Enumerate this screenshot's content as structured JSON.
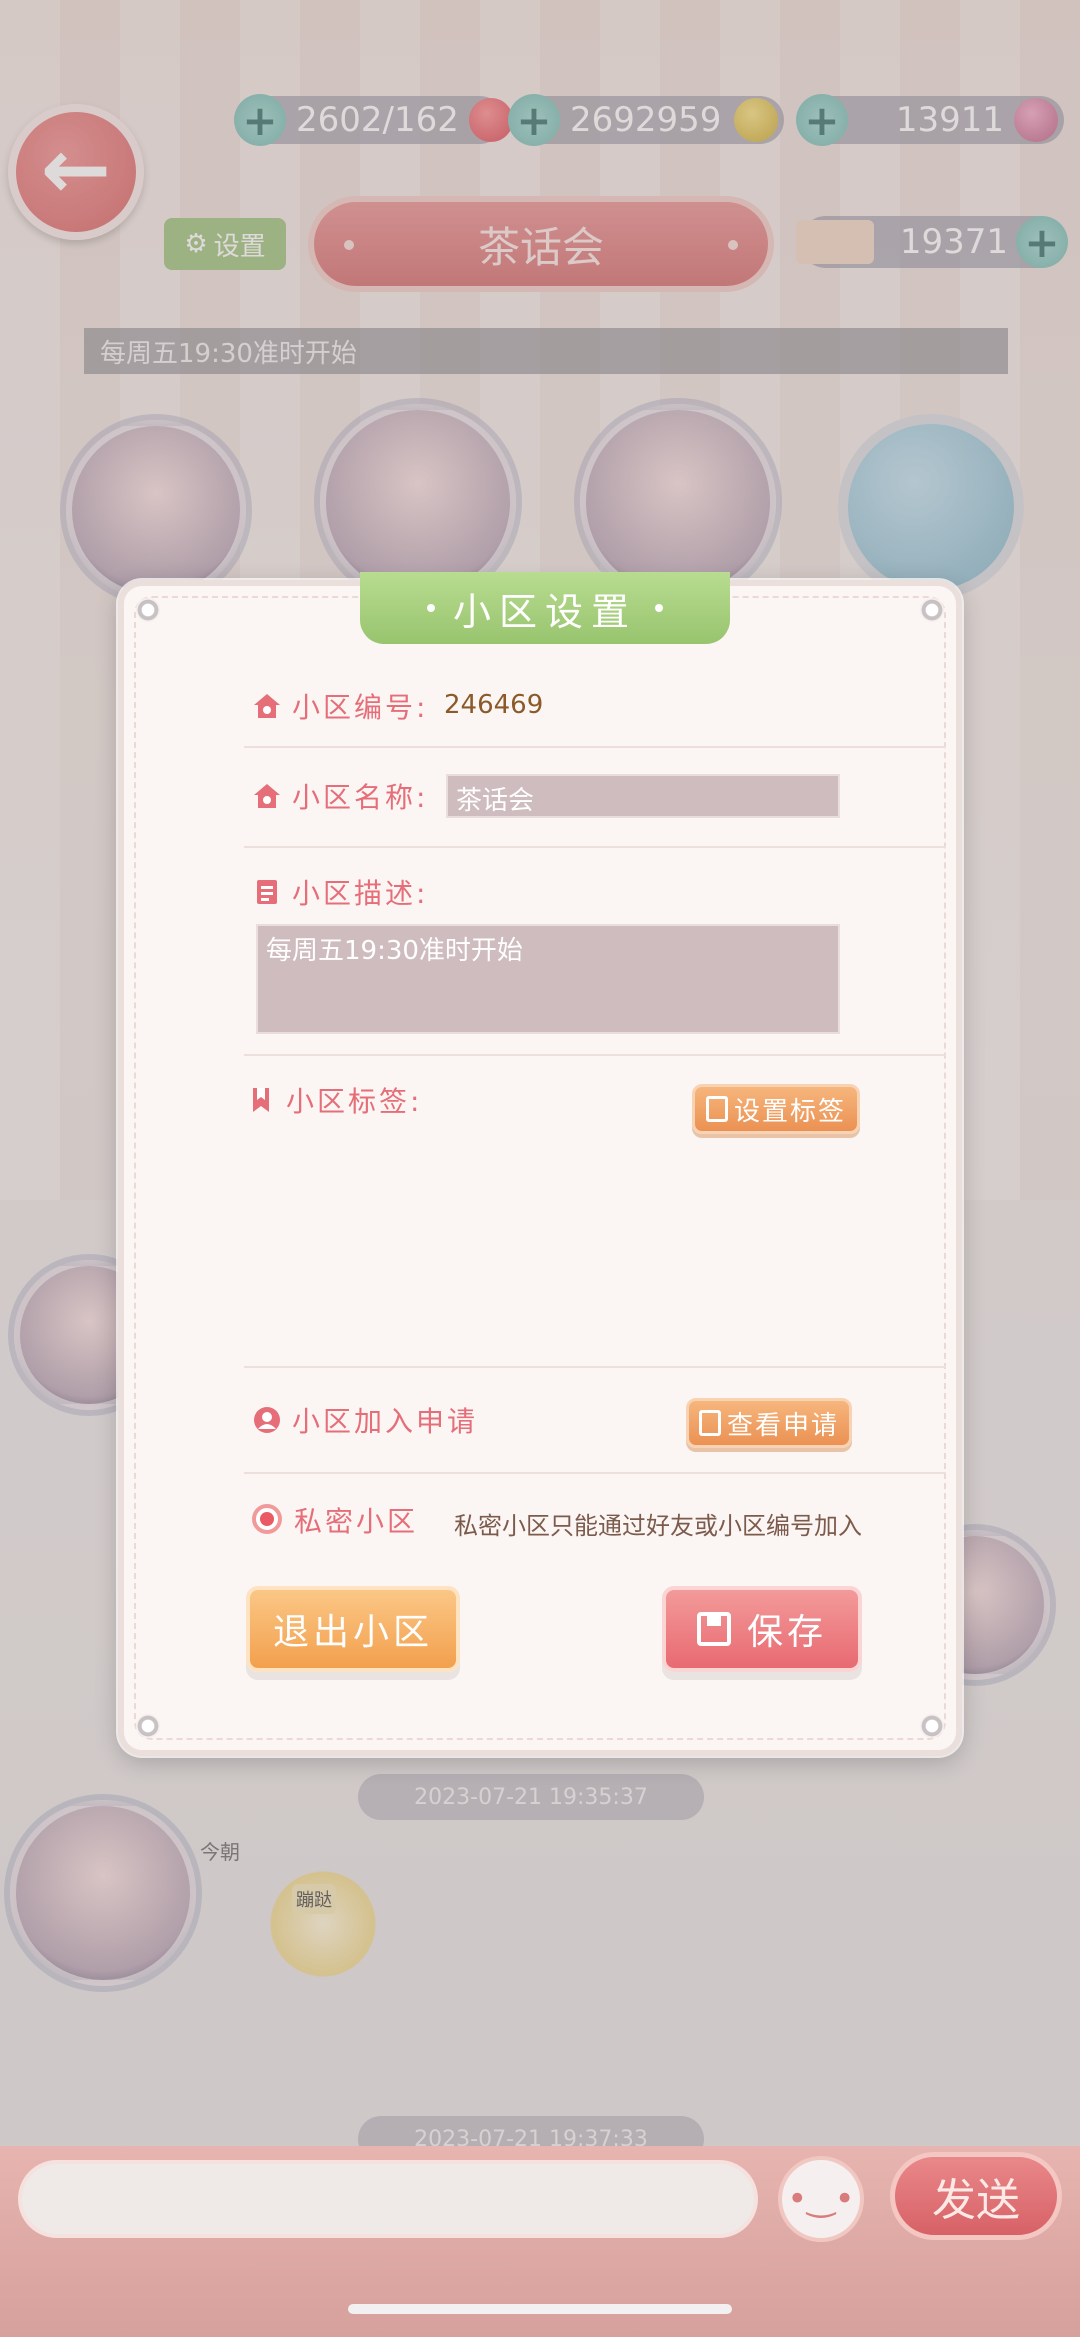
{
  "header": {
    "resources": [
      {
        "value": "2602/162",
        "icon": "heart-icon"
      },
      {
        "value": "2692959",
        "icon": "coin-icon"
      },
      {
        "value": "13911",
        "icon": "gem-icon"
      }
    ],
    "settings_label": "设置",
    "room_title": "茶话会",
    "ticket_value": "19371",
    "notice": "每周五19:30准时开始"
  },
  "chat": {
    "timestamps": [
      "2023-07-21 19:35:37",
      "2023-07-21 19:37:33"
    ],
    "sender_name": "今朝",
    "sticker_text": "蹦跶"
  },
  "input_bar": {
    "send_label": "发送"
  },
  "modal": {
    "title": "小区设置",
    "community_id_label": "小区编号:",
    "community_id_value": "246469",
    "community_name_label": "小区名称:",
    "community_name_value": "茶话会",
    "description_label": "小区描述:",
    "description_value": "每周五19:30准时开始",
    "tags_label": "小区标签:",
    "set_tags_button": "设置标签",
    "join_request_label": "小区加入申请",
    "view_request_button": "查看申请",
    "private_label": "私密小区",
    "private_desc": "私密小区只能通过好友或小区编号加入",
    "exit_button": "退出小区",
    "save_button": "保存"
  },
  "colors": {
    "accent_pink": "#e56e78",
    "title_green": "#98c46e",
    "orange_button": "#eb9153"
  }
}
